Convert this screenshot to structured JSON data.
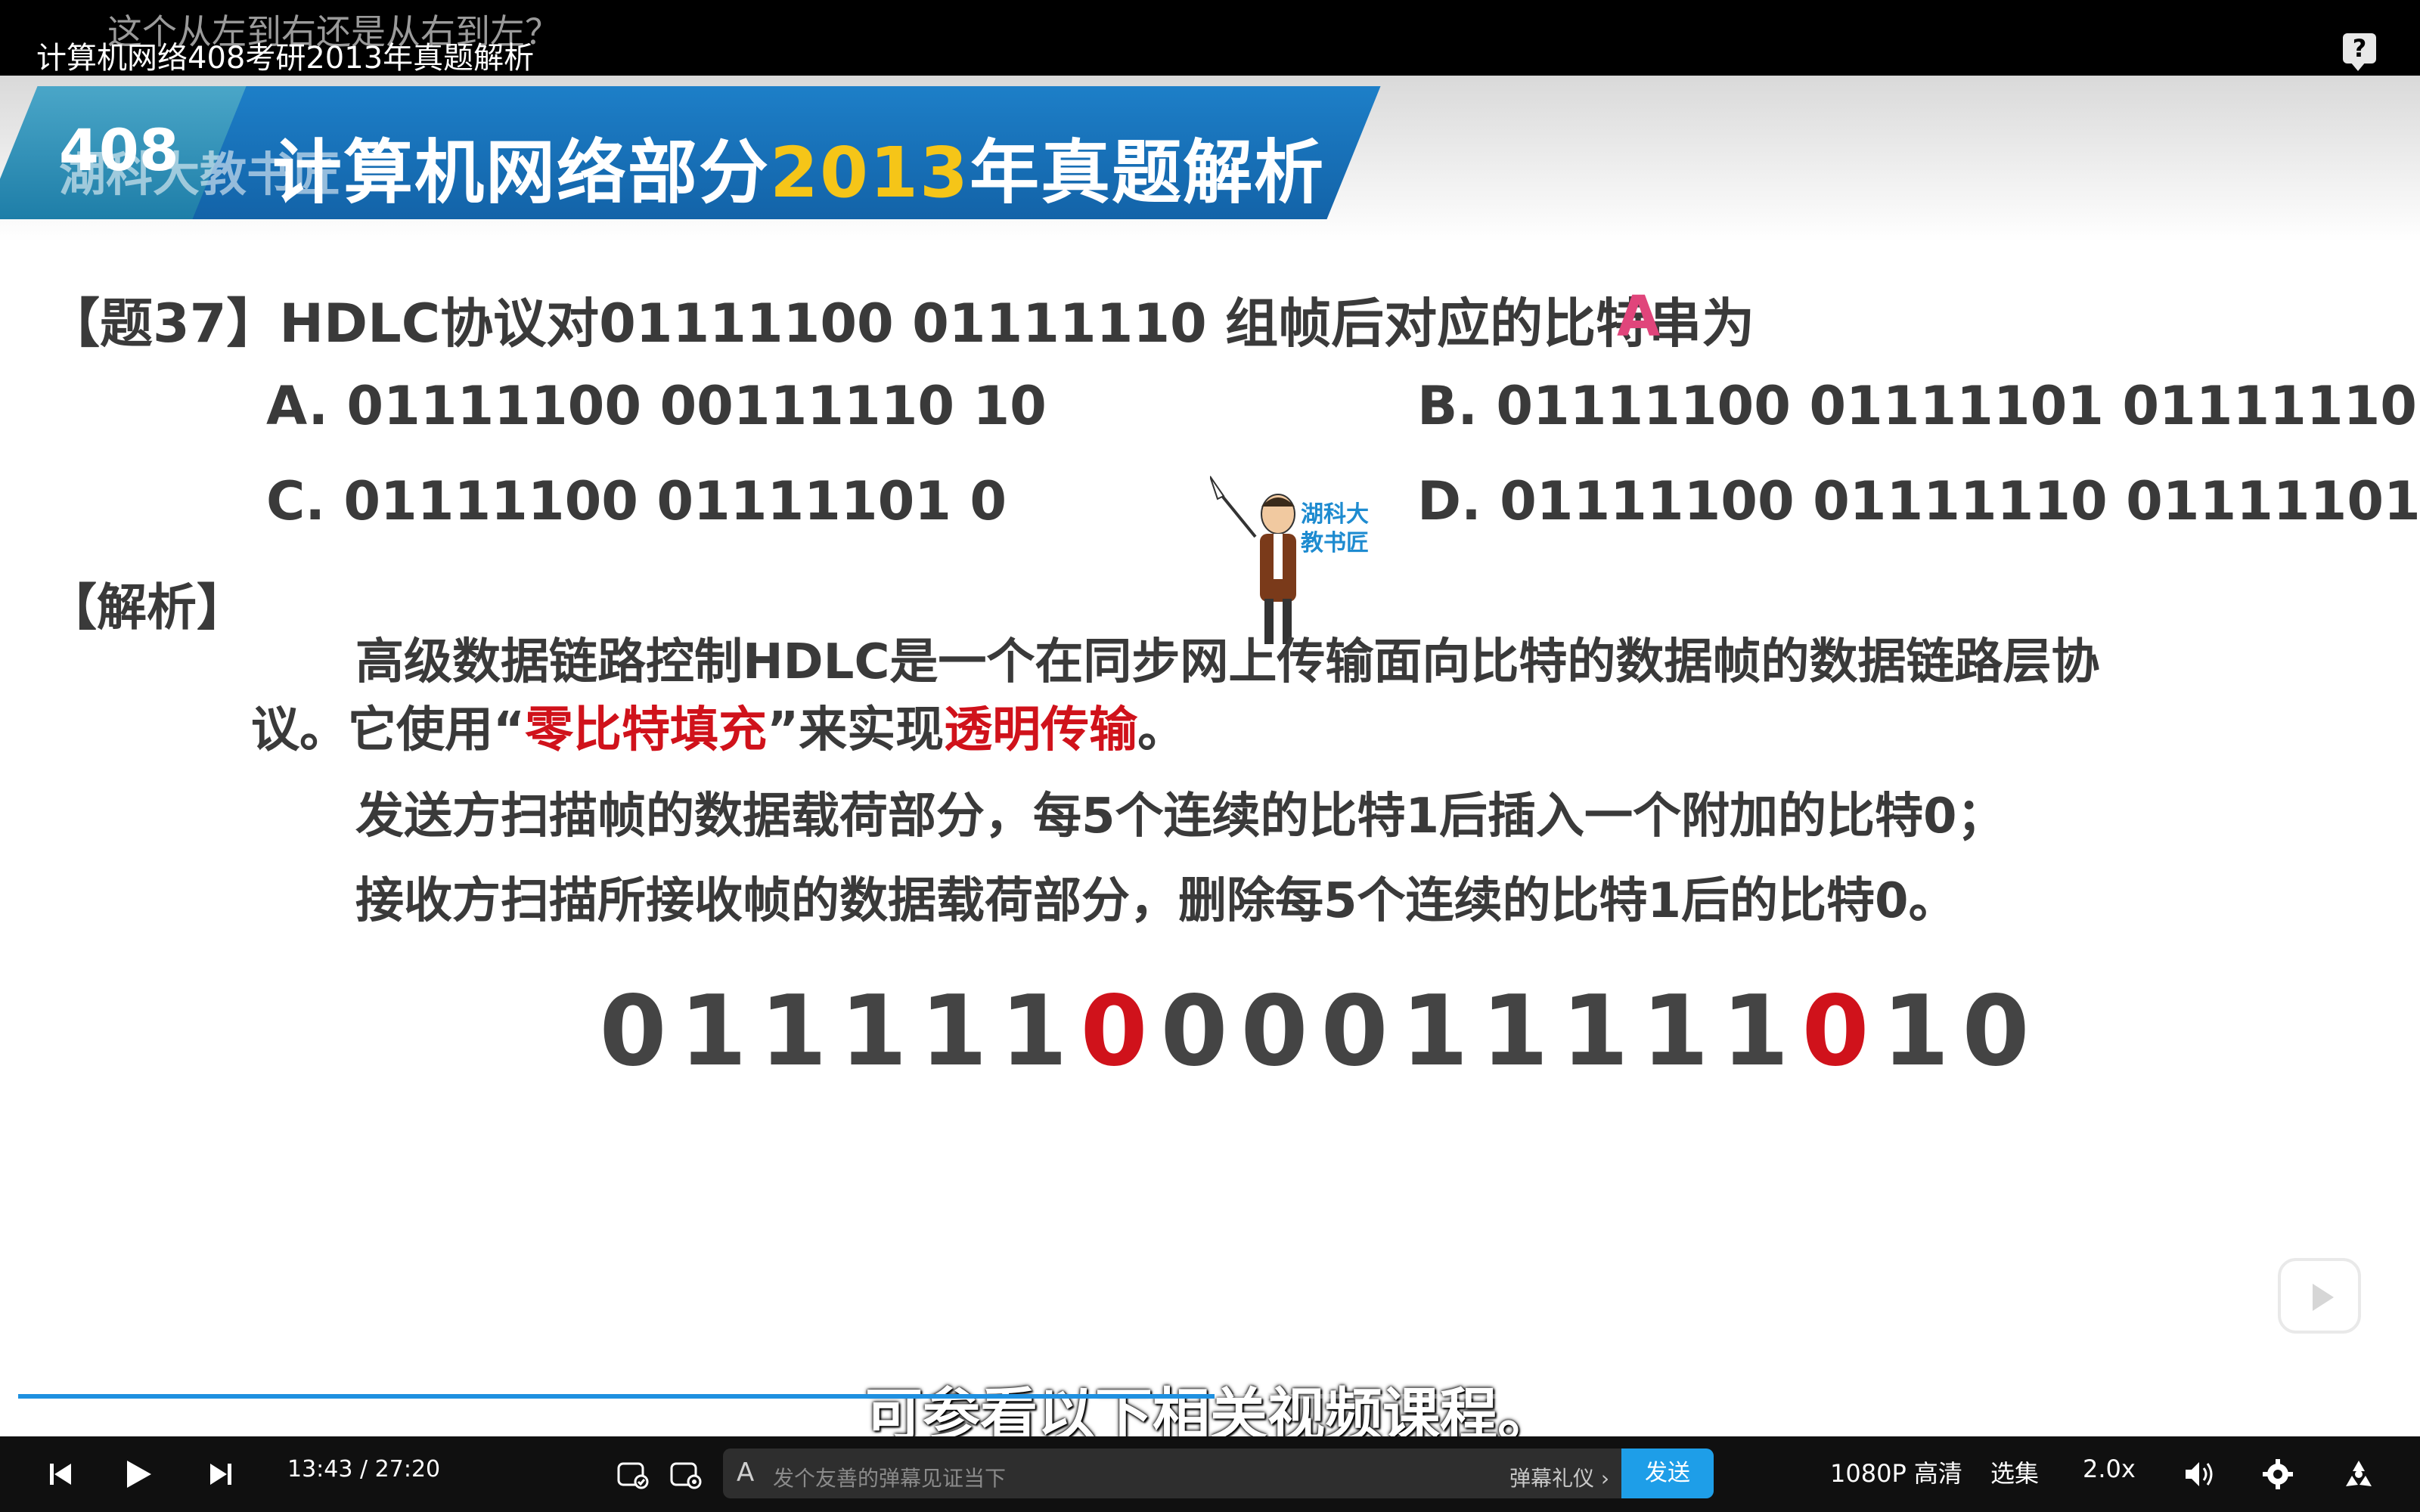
{
  "header": {
    "video_title": "计算机网络408考研2013年真题解析",
    "danmaku_top": "这个从左到右还是从右到左？",
    "help_label": "?"
  },
  "slide": {
    "banner_code": "408",
    "banner_watermark": "湖科大教书匠",
    "banner_title_pre": "计算机网络部分",
    "banner_title_year": "2013",
    "banner_title_post": "年真题解析",
    "question": "【题37】HDLC协议对01111100 01111110 组帧后对应的比特串为",
    "answer": "A",
    "options": {
      "a": "A. 01111100 00111110 10",
      "b": "B. 01111100 01111101 01111110",
      "c": "C. 01111100 01111101 0",
      "d": "D. 01111100 01111110 01111101"
    },
    "teacher_label": "湖科大教书匠",
    "analysis_head": "【解析】",
    "p1": "高级数据链路控制HDLC是一个在同步网上传输面向比特的数据帧的数据链路层协",
    "p2_a": "议。它使用“",
    "p2_red1": "零比特填充",
    "p2_b": "”来实现",
    "p2_red2": "透明传输",
    "p2_c": "。",
    "p3": "发送方扫描帧的数据载荷部分，每5个连续的比特1后插入一个附加的比特0；",
    "p4": "接收方扫描所接收帧的数据载荷部分，删除每5个连续的比特1后的比特0。",
    "bits": [
      "0",
      "1",
      "1",
      "1",
      "1",
      "1",
      "0",
      "0",
      "0",
      "0",
      "1",
      "1",
      "1",
      "1",
      "1",
      "0",
      "1",
      "0"
    ],
    "bits_red": [
      6,
      15
    ],
    "subtitle": "可参看以下相关视频课程。"
  },
  "player": {
    "current_time": "13:43",
    "separator": "/",
    "duration": "27:20",
    "progress_fraction": 0.502,
    "danmaku_placeholder": "发个友善的弹幕见证当下",
    "danmaku_etiquette": "弹幕礼仪 ›",
    "send_label": "发送",
    "quality": "1080P 高清",
    "episodes": "选集",
    "speed": "2.0x"
  }
}
